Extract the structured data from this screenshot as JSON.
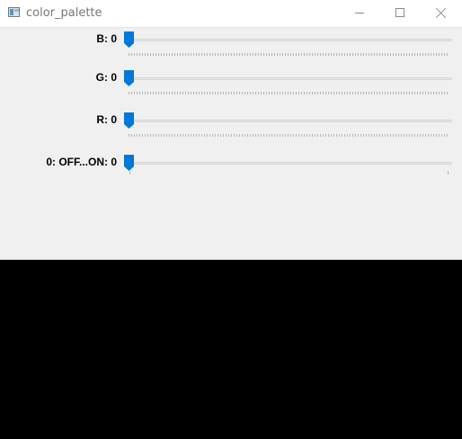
{
  "window": {
    "title": "color_palette"
  },
  "controls": {
    "trackbars": [
      {
        "label": "B: 0",
        "value": 0
      },
      {
        "label": "G: 0",
        "value": 0
      },
      {
        "label": "R: 0",
        "value": 0
      },
      {
        "label": "0: OFF...ON: 0",
        "value": 0
      }
    ]
  },
  "colors": {
    "thumb": "#0078d7",
    "preview": "#000000",
    "panel": "#f0f0f0"
  },
  "icons": {
    "minimize": "minimize-icon",
    "maximize": "maximize-icon",
    "close": "close-icon"
  }
}
